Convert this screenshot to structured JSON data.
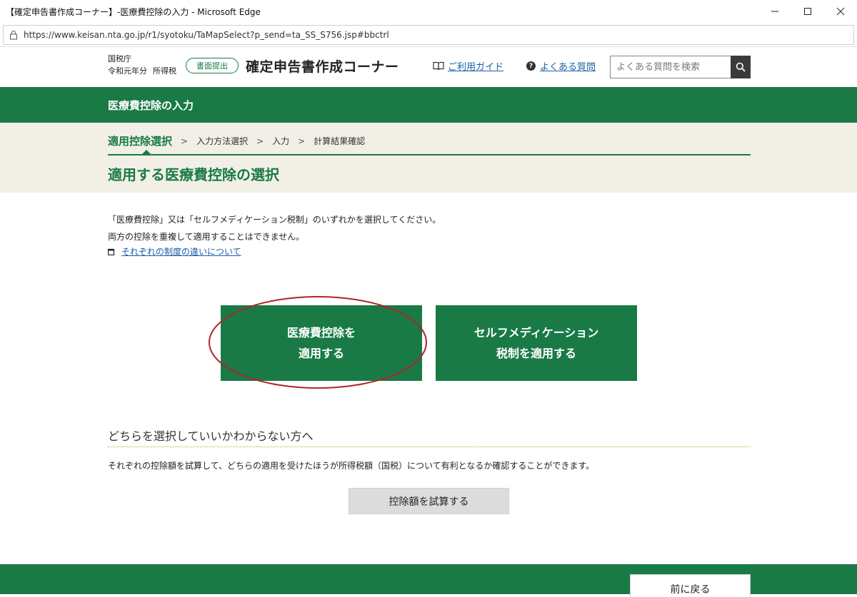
{
  "window": {
    "title": "【確定申告書作成コーナー】-医療費控除の入力 - Microsoft Edge",
    "url": "https://www.keisan.nta.go.jp/r1/syotoku/TaMapSelect?p_send=ta_SS_S756.jsp#bbctrl"
  },
  "header": {
    "agency": "国税庁",
    "year": "令和元年分",
    "tax_type": "所得税",
    "badge": "書面提出",
    "site_title": "確定申告書作成コーナー",
    "guide_link": "ご利用ガイド",
    "faq_link": "よくある質問",
    "search_placeholder": "よくある質問を検索"
  },
  "page_bar": {
    "title": "医療費控除の入力"
  },
  "steps": {
    "items": [
      "適用控除選択",
      "入力方法選択",
      "入力",
      "計算結果確認"
    ],
    "active_index": 0
  },
  "section_title": "適用する医療費控除の選択",
  "intro": {
    "line1": "「医療費控除」又は「セルフメディケーション税制」のいずれかを選択してください。",
    "line2": "両方の控除を重複して適用することはできません。",
    "link": "それぞれの制度の違いについて"
  },
  "choices": {
    "medical": {
      "line1": "医療費控除を",
      "line2": "適用する"
    },
    "self_medication": {
      "line1": "セルフメディケーション",
      "line2": "税制を適用する"
    }
  },
  "unsure": {
    "heading": "どちらを選択していいかわからない方へ",
    "text": "それぞれの控除額を試算して、どちらの適用を受けたほうが所得税額（国税）について有利となるか確認することができます。",
    "button": "控除額を試算する"
  },
  "footer": {
    "back_button": "前に戻る"
  },
  "colors": {
    "brand_green": "#1a7a46",
    "beige": "#f2f0e6",
    "link": "#1a5fa8",
    "highlight_red": "#b0242a"
  }
}
